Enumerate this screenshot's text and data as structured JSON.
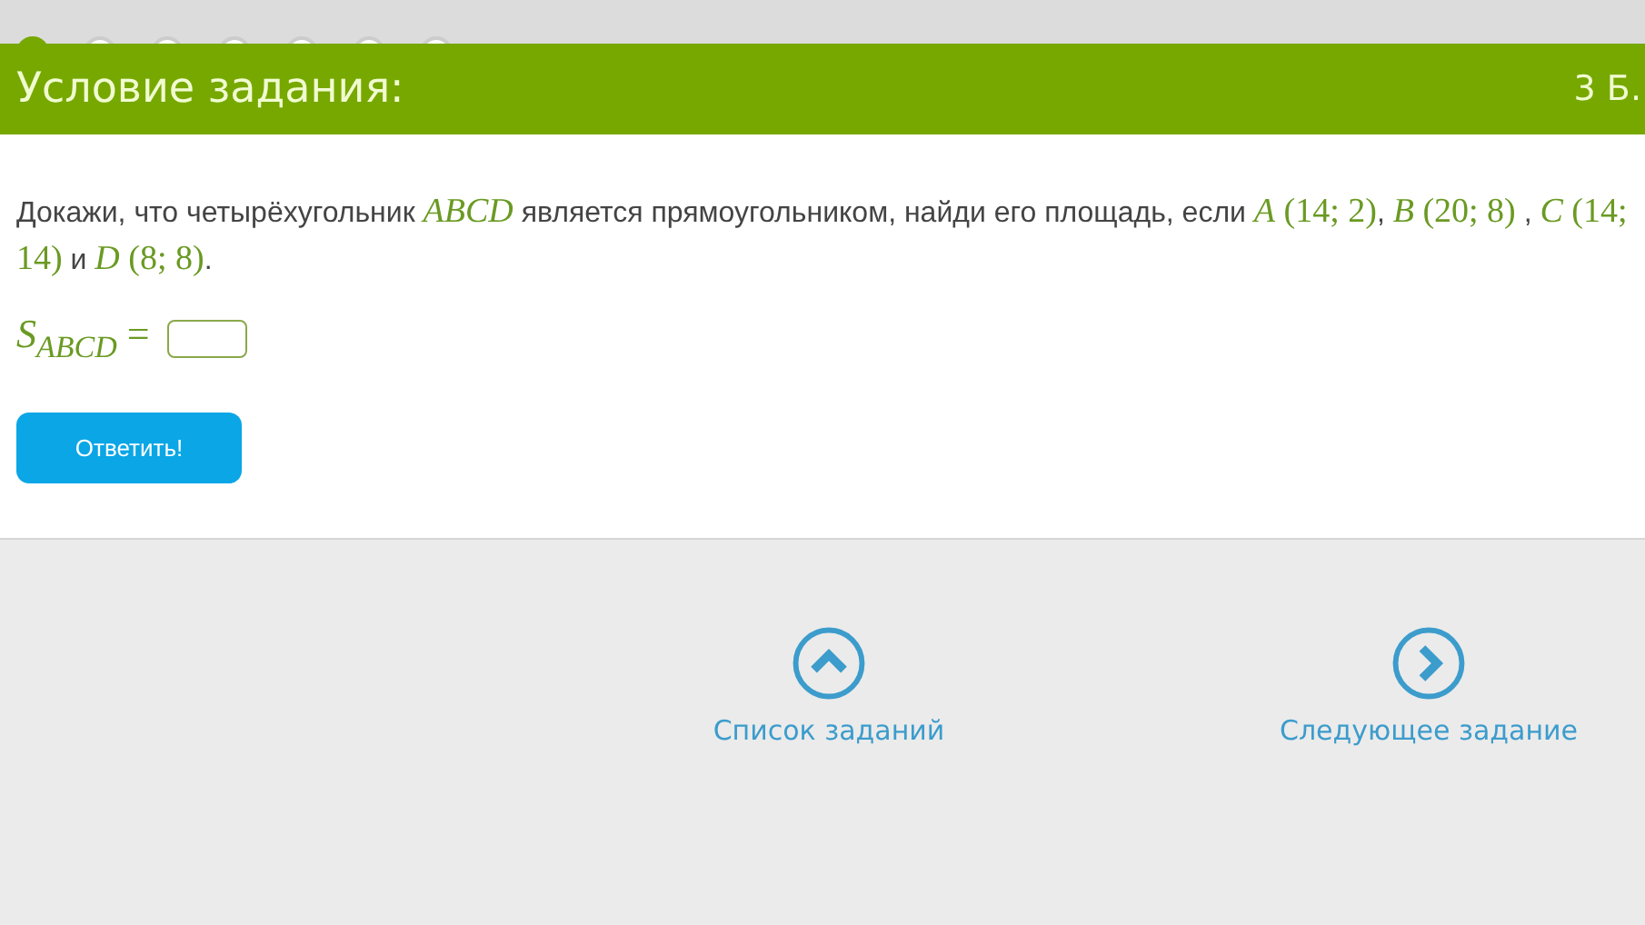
{
  "steps": [
    {
      "done": true
    },
    {
      "done": false
    },
    {
      "done": false
    },
    {
      "done": false
    },
    {
      "done": false
    },
    {
      "done": false
    },
    {
      "done": false
    }
  ],
  "header": {
    "title": "Условие задания:",
    "score": "3 Б."
  },
  "problem": {
    "segments": [
      {
        "kind": "text",
        "text": "Докажи, что четырёхугольник "
      },
      {
        "kind": "math",
        "text": "*ABCD*"
      },
      {
        "kind": "text",
        "text": " является прямоугольником, найди его площадь, если "
      },
      {
        "kind": "math",
        "text": "*A* (14; 2)"
      },
      {
        "kind": "text",
        "text": ", "
      },
      {
        "kind": "math",
        "text": "*B* (20; 8)"
      },
      {
        "kind": "text",
        "text": " , "
      },
      {
        "kind": "math",
        "text": "*C* (14; 14)"
      },
      {
        "kind": "text",
        "text": " и "
      },
      {
        "kind": "math",
        "text": "*D* (8; 8)"
      },
      {
        "kind": "text",
        "text": "."
      }
    ]
  },
  "answer": {
    "formula": "*S*$_{ABCD}$ ="
  },
  "submit": "Ответить!",
  "nav": [
    {
      "kind": "up",
      "label": "Список заданий"
    },
    {
      "kind": "next",
      "label": "Следующее задание"
    }
  ]
}
